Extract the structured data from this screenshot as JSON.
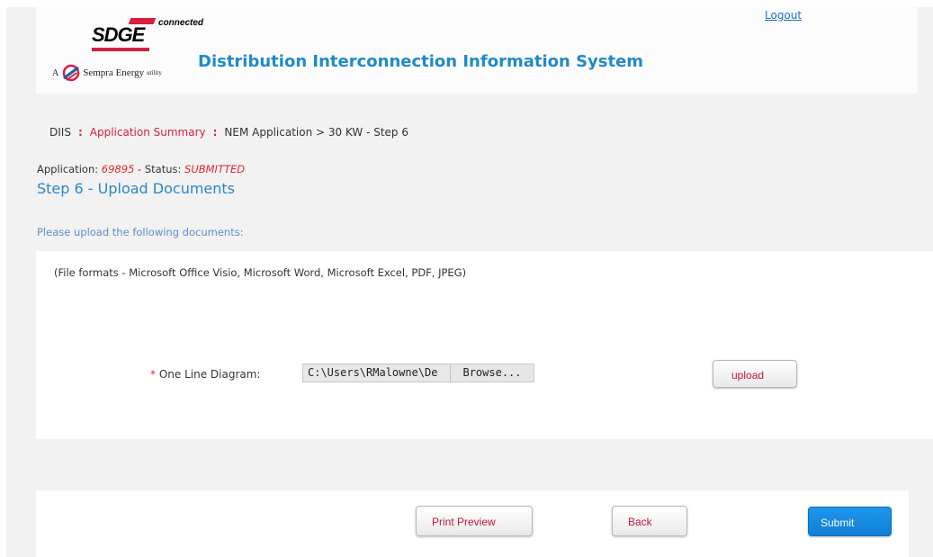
{
  "header": {
    "logo": {
      "brand": "SDGE",
      "tagline": "connected",
      "parent_prefix": "A",
      "parent_name": "Sempra Energy",
      "parent_suffix": "utility"
    },
    "title": "Distribution Interconnection Information System",
    "logout_label": "Logout"
  },
  "breadcrumb": {
    "items": [
      "DIIS",
      "Application Summary",
      "NEM Application > 30 KW - Step 6"
    ]
  },
  "application": {
    "label": "Application:",
    "number": "69895",
    "status_label": "- Status:",
    "status": "SUBMITTED"
  },
  "step_title": "Step 6 - Upload Documents",
  "instructions": "Please upload the following documents:",
  "formats_note": "(File formats - Microsoft Office Visio, Microsoft Word, Microsoft Excel, PDF, JPEG)",
  "upload_field": {
    "required_marker": "*",
    "label": "One Line Diagram:",
    "value": "C:\\Users\\RMalowne\\De",
    "browse_label": "Browse...",
    "upload_label": "upload"
  },
  "footer": {
    "print_label": "Print Preview",
    "back_label": "Back",
    "submit_label": "Submit"
  },
  "colors": {
    "accent_blue": "#1f8ac9",
    "brand_red": "#d71f3d",
    "submit_blue": "#1a8be0"
  }
}
